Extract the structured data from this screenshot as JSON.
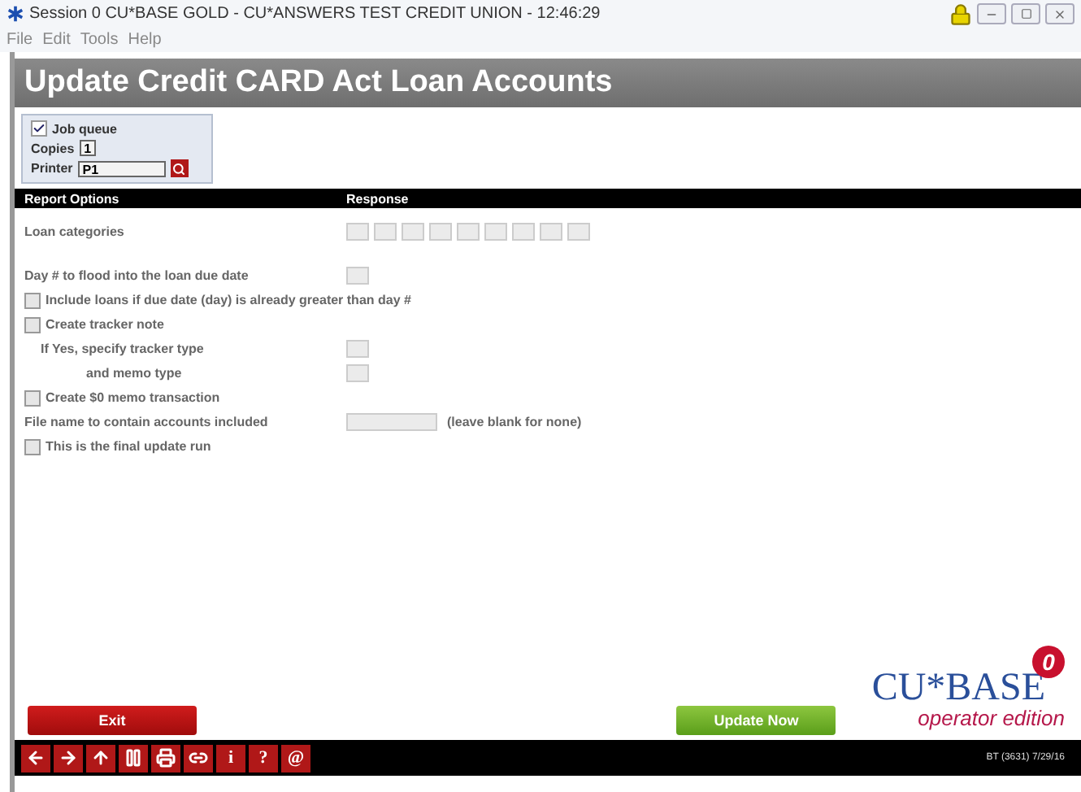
{
  "window": {
    "title": "Session 0 CU*BASE GOLD - CU*ANSWERS TEST CREDIT UNION - 12:46:29"
  },
  "menu": [
    "File",
    "Edit",
    "Tools",
    "Help"
  ],
  "header": "Update Credit CARD Act Loan Accounts",
  "job": {
    "job_queue": {
      "label": "Job queue",
      "checked": true
    },
    "copies": {
      "label": "Copies",
      "value": "1"
    },
    "printer": {
      "label": "Printer",
      "value": "P1"
    }
  },
  "columns": [
    "Report Options",
    "Response"
  ],
  "rows": [
    {
      "kind": "field",
      "label": "Loan categories",
      "fields": [
        {
          "kind": "short"
        },
        {
          "kind": "short"
        },
        {
          "kind": "short"
        },
        {
          "kind": "short"
        },
        {
          "kind": "short"
        },
        {
          "kind": "short"
        },
        {
          "kind": "short"
        },
        {
          "kind": "short"
        },
        {
          "kind": "short"
        }
      ]
    },
    {
      "kind": "gap"
    },
    {
      "kind": "field",
      "label": "Day # to flood into the loan due date",
      "fields": [
        {
          "kind": "short"
        }
      ]
    },
    {
      "kind": "check",
      "label": "Include loans if due date (day) is already greater than day #",
      "checked": false
    },
    {
      "kind": "check",
      "label": "Create tracker note",
      "checked": false
    },
    {
      "kind": "subfield",
      "label": "If Yes, specify tracker type",
      "fields": [
        {
          "kind": "short"
        }
      ]
    },
    {
      "kind": "continuation",
      "label": "and memo type",
      "fields": [
        {
          "kind": "short"
        }
      ]
    },
    {
      "kind": "check",
      "label": "Create $0 memo transaction",
      "checked": false
    },
    {
      "kind": "field",
      "label": "File name to contain accounts included",
      "fields": [
        {
          "kind": "wide"
        }
      ],
      "note": "(leave blank for none)"
    },
    {
      "kind": "check",
      "label": "This is the final update run",
      "checked": false
    }
  ],
  "buttons": {
    "exit": "Exit",
    "update": "Update Now"
  },
  "logo": {
    "name": "CU*BASE",
    "badge": "0",
    "tagline": "operator edition"
  },
  "toolbar": [
    {
      "kind": "back"
    },
    {
      "kind": "forward"
    },
    {
      "kind": "up"
    },
    {
      "kind": "pause"
    },
    {
      "kind": "printer"
    },
    {
      "kind": "link"
    },
    {
      "kind": "char",
      "label": "i"
    },
    {
      "kind": "char",
      "label": "?"
    },
    {
      "kind": "char",
      "label": "@"
    }
  ],
  "status": "BT (3631) 7/29/16"
}
